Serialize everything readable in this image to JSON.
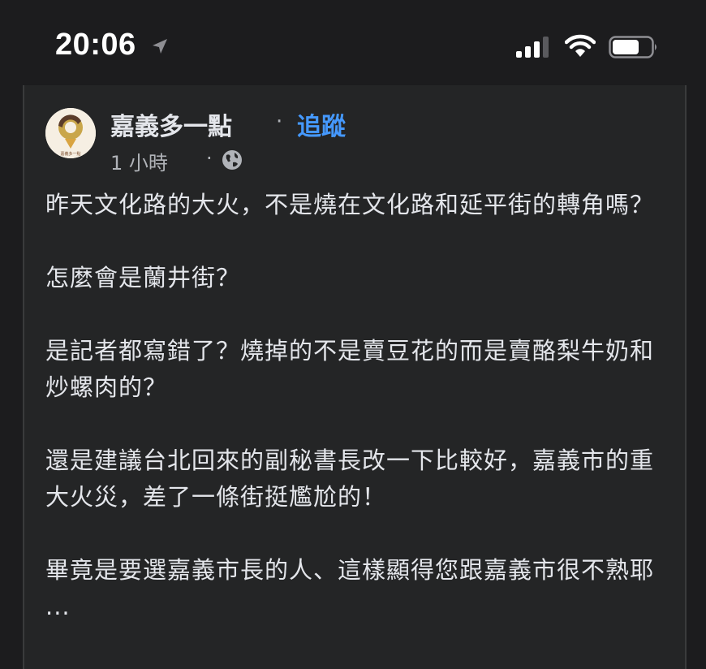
{
  "status_bar": {
    "time": "20:06",
    "icons": [
      "location-arrow-icon",
      "cellular-signal-icon",
      "wifi-icon",
      "battery-icon"
    ]
  },
  "post": {
    "page_name": "嘉義多一點",
    "separator": "·",
    "follow_label": "追蹤",
    "timestamp": "1 小時",
    "meta_separator": "·",
    "privacy_icon": "globe-icon",
    "avatar_caption": "嘉義多一點",
    "paragraphs": [
      "昨天文化路的大火，不是燒在文化路和延平街的轉角嗎？",
      "怎麼會是蘭井街？",
      "是記者都寫錯了？燒掉的不是賣豆花的而是賣酪梨牛奶和炒螺肉的？",
      "還是建議台北回來的副秘書長改一下比較好，嘉義市的重大火災，差了一條街挺尷尬的！",
      "畢竟是要選嘉義市長的人、這樣顯得您跟嘉義市很不熟耶 ..."
    ]
  },
  "colors": {
    "background": "#1c1c1e",
    "card": "#242526",
    "text": "#e4e6eb",
    "secondary_text": "#b0b3b8",
    "link": "#4599ff"
  }
}
